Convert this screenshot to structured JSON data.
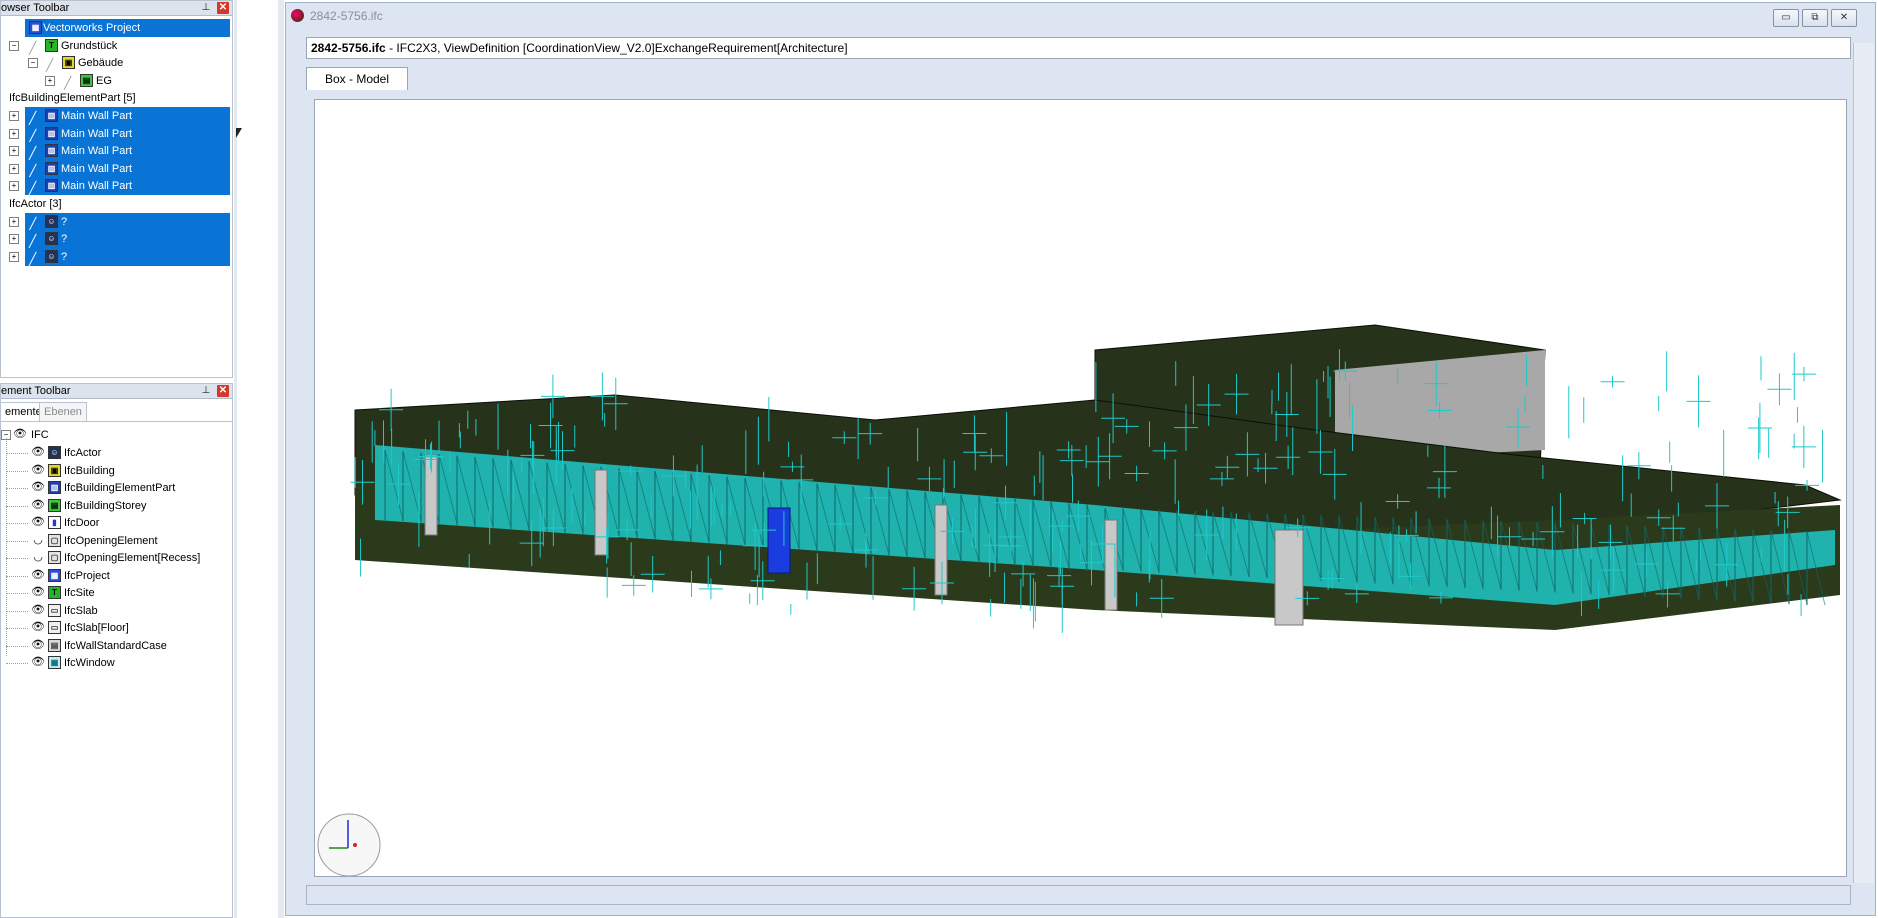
{
  "browser_panel": {
    "title": "owser Toolbar",
    "rows": [
      {
        "label": "Vectorworks Project",
        "selected": true,
        "icon": "project-icon"
      },
      {
        "label": "Grundstück",
        "selected": false,
        "icon": "site-icon"
      },
      {
        "label": "Gebäude",
        "selected": false,
        "icon": "building-icon"
      },
      {
        "label": "EG",
        "selected": false,
        "icon": "storey-icon"
      },
      {
        "label": "IfcBuildingElementPart [5]",
        "selected": false
      },
      {
        "label": "Main Wall Part",
        "selected": true,
        "icon": "element-part-icon"
      },
      {
        "label": "Main Wall Part",
        "selected": true,
        "icon": "element-part-icon"
      },
      {
        "label": "Main Wall Part",
        "selected": true,
        "icon": "element-part-icon"
      },
      {
        "label": "Main Wall Part",
        "selected": true,
        "icon": "element-part-icon"
      },
      {
        "label": "Main Wall Part",
        "selected": true,
        "icon": "element-part-icon"
      },
      {
        "label": "IfcActor [3]",
        "selected": false
      },
      {
        "label": "?",
        "selected": true,
        "icon": "actor-icon"
      },
      {
        "label": "?",
        "selected": true,
        "icon": "actor-icon"
      },
      {
        "label": "?",
        "selected": true,
        "icon": "actor-icon"
      }
    ]
  },
  "element_panel": {
    "title": "ement Toolbar",
    "tabs": [
      "emente",
      "Ebenen"
    ],
    "root": "IFC",
    "items": [
      {
        "label": "IfcActor",
        "icon": "actor-icon",
        "visible": true
      },
      {
        "label": "IfcBuilding",
        "icon": "building-icon",
        "visible": true
      },
      {
        "label": "IfcBuildingElementPart",
        "icon": "element-part-icon",
        "visible": true
      },
      {
        "label": "IfcBuildingStorey",
        "icon": "storey-icon",
        "visible": true
      },
      {
        "label": "IfcDoor",
        "icon": "door-icon",
        "visible": true
      },
      {
        "label": "IfcOpeningElement",
        "icon": "opening-icon",
        "visible": false
      },
      {
        "label": "IfcOpeningElement[Recess]",
        "icon": "opening-icon",
        "visible": false
      },
      {
        "label": "IfcProject",
        "icon": "project-icon",
        "visible": true
      },
      {
        "label": "IfcSite",
        "icon": "site-icon",
        "visible": true
      },
      {
        "label": "IfcSlab",
        "icon": "slab-icon",
        "visible": true
      },
      {
        "label": "IfcSlab[Floor]",
        "icon": "slab-icon",
        "visible": true
      },
      {
        "label": "IfcWallStandardCase",
        "icon": "wall-icon",
        "visible": true
      },
      {
        "label": "IfcWindow",
        "icon": "window-icon",
        "visible": true
      }
    ]
  },
  "document_window": {
    "title": "2842-5756.ifc",
    "info_filename": "2842-5756.ifc",
    "info_rest": " - IFC2X3, ViewDefinition [CoordinationView_V2.0]ExchangeRequirement[Architecture]",
    "tab_label": "Box - Model",
    "buttons": {
      "minimize": "▭",
      "restore": "⧉",
      "close": "✕"
    }
  },
  "colors": {
    "selection": "#0a74d6",
    "glass": "#1fc9c9",
    "slab": "#26321a",
    "door": "#1a3de0"
  }
}
